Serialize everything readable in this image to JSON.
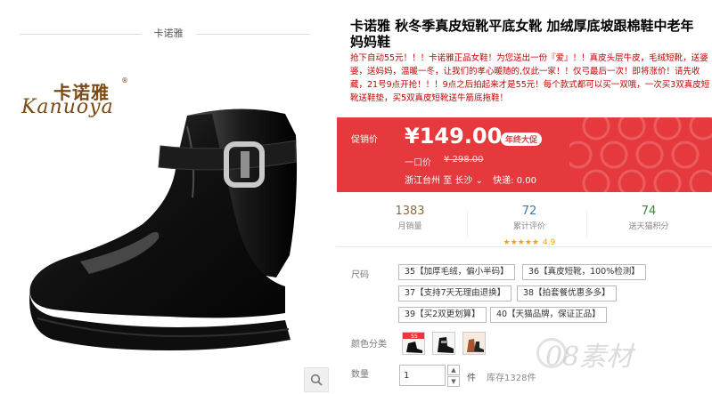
{
  "store": {
    "name": "卡诺雅"
  },
  "logo": {
    "cn": "卡诺雅",
    "en": "Kanuoya",
    "reg": "®"
  },
  "product": {
    "title": "卡诺雅 秋冬季真皮短靴平底女靴 加绒厚底坡跟棉鞋中老年妈妈鞋",
    "description": "抢下自动55元！！！卡诺雅正品女鞋！为您送出一份『爱』！！真皮头层牛皮，毛绒短靴，送婆婆，送妈妈，温暖一冬，让我们的孝心暖随的,仅此一家！！仅弓最后一次！即将涨价！请先收藏，21号9点开抢！！！9点之后拍起来才是55元！每个款式都可以买一双哦，一次买3双真皮短靴送鞋垫，买5双真皮短靴送牛筋底拖鞋！"
  },
  "price": {
    "label": "促销价",
    "value": "¥149.00",
    "badge": "年终大促",
    "original_label": "一口价",
    "original_value": "¥ 298.00",
    "ship_from": "浙江台州",
    "ship_to_word": "至",
    "ship_to": "长沙",
    "ship_fee": "快递: 0.00"
  },
  "stats": [
    {
      "num": "1383",
      "label": "月销量"
    },
    {
      "num": "72",
      "label": "累计评价",
      "stars": "★★★★★",
      "rating": "4.9"
    },
    {
      "num": "74",
      "label": "送天猫积分"
    }
  ],
  "sizes": {
    "label": "尺码",
    "options": [
      "35【加厚毛绒，偏小半码】",
      "36【真皮短靴，100%检测】",
      "37【支持7天无理由退换】",
      "38【拍套餐优惠多多】",
      "39【买2双更划算】",
      "40【天猫品牌，保证正品】"
    ]
  },
  "colors": {
    "label": "颜色分类",
    "swatch_badge": "55"
  },
  "quantity": {
    "label": "数量",
    "value": "1",
    "unit": "件",
    "stock": "库存1328件"
  },
  "watermark": {
    "text": "08素材"
  },
  "accent": "#e5393e"
}
